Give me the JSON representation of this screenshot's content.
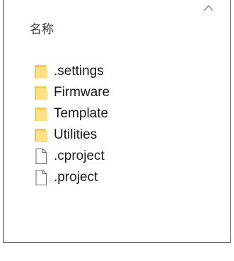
{
  "header": {
    "name_column": "名称"
  },
  "colors": {
    "folder_fill": "#FFE08A",
    "folder_tab": "#F2C94C",
    "file_outline": "#6b6b6b"
  },
  "items": [
    {
      "name": ".settings",
      "type": "folder",
      "icon": "folder-icon"
    },
    {
      "name": "Firmware",
      "type": "folder",
      "icon": "folder-icon"
    },
    {
      "name": "Template",
      "type": "folder",
      "icon": "folder-icon"
    },
    {
      "name": "Utilities",
      "type": "folder",
      "icon": "folder-icon"
    },
    {
      "name": ".cproject",
      "type": "file",
      "icon": "file-icon"
    },
    {
      "name": ".project",
      "type": "file",
      "icon": "file-icon"
    }
  ]
}
